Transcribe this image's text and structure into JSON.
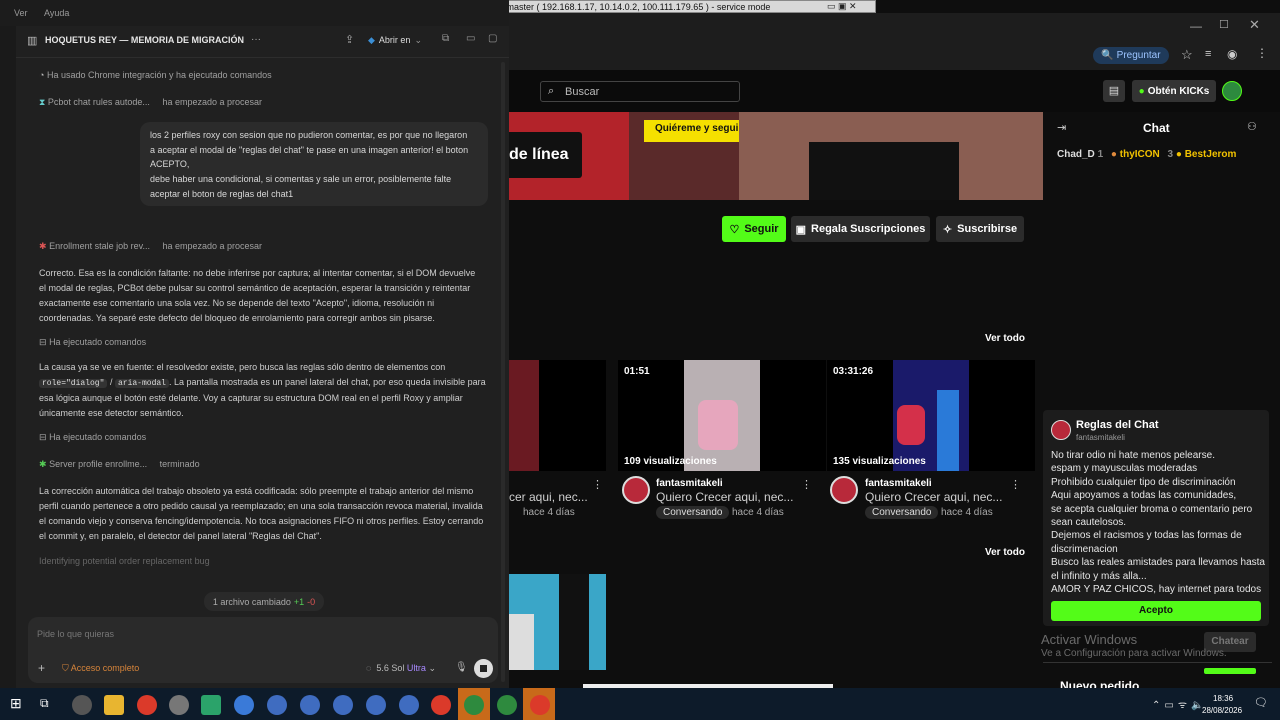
{
  "remote_title": "pcmaster ( 192.168.1.17, 10.14.0.2, 100.111.179.65 ) - service mode",
  "left_panel": {
    "menu": [
      "Ver",
      "Ayuda"
    ],
    "title": "HOQUETUS REY — MEMORIA DE MIGRACIÓN",
    "open_in_label": "Abrir en",
    "status1": "Ha usado Chrome integración y ha ejecutado comandos",
    "task1_name": "Pcbot chat rules autode...",
    "task1_state": "ha empezado a procesar",
    "bubble_lines": [
      "los 2 perfiles roxy con sesion que no pudieron comentar, es por que no llegaron",
      "a aceptar el modal de \"reglas del chat\" te pase en una imagen anterior! el boton",
      "ACEPTO,",
      "debe haber una condicional, si comentas y sale un error, posiblemente falte",
      "aceptar el boton de reglas del chat1"
    ],
    "task2_name": "Enrollment stale job rev...",
    "task2_state": "ha empezado a procesar",
    "para1": [
      "Correcto. Esa es la condición faltante: no debe inferirse por captura; al intentar comentar, si el DOM devuelve",
      "el modal de reglas, PCBot debe pulsar su control semántico de aceptación, esperar la transición y reintentar",
      "exactamente ese comentario una sola vez. No se depende del texto \"Acepto\", idioma, resolución ni",
      "coordenadas. Ya separé este defecto del bloqueo de enrolamiento para corregir ambos sin pisarse."
    ],
    "exec1": "Ha ejecutado comandos",
    "para2_line1": "La causa ya se ve en fuente: el resolvedor existe, pero busca las reglas sólo dentro de elementos con",
    "para2_code1": "role=\"dialog\"",
    "para2_sep": "/",
    "para2_code2": "aria-modal",
    "para2_line2_rest": ". La pantalla mostrada es un panel lateral del chat, por eso queda invisible para",
    "para2_line3": "esa lógica aunque el botón esté delante. Voy a capturar su estructura DOM real en el perfil Roxy y ampliar",
    "para2_line4": "únicamente ese detector semántico.",
    "exec2": "Ha ejecutado comandos",
    "task3_name": "Server profile enrollme...",
    "task3_state": "terminado",
    "para3": [
      "La corrección automática del trabajo obsoleto ya está codificada: sólo preempte el trabajo anterior del mismo",
      "perfil cuando pertenece a otro pedido causal ya reemplazado; en una sola transacción revoca material, invalida",
      "el comando viejo y conserva fencing/idempotencia. No toca asignaciones FIFO ni otros perfiles. Estoy cerrando",
      "el commit y, en paralelo, el detector del panel lateral \"Reglas del Chat\"."
    ],
    "thinking": "Identifying potential order replacement bug",
    "files_changed": "1 archivo cambiado",
    "files_plus": "+1",
    "files_minus": "-0",
    "input_placeholder": "Pide lo que quieras",
    "access_label": "Acceso completo",
    "model_label": "5.6 Sol",
    "model_tier": "Ultra"
  },
  "stream": {
    "search_placeholder": "Buscar",
    "get_kicks": "Obtén KICKs",
    "offline_text": "de línea",
    "banner_text": "Quiéreme y seguir",
    "follow_label": "Seguir",
    "gift_label": "Regala Suscripciones",
    "subscribe_label": "Suscribirse",
    "see_all_1": "Ver todo",
    "see_all_2": "Ver todo",
    "videos": [
      {
        "duration": "",
        "views": "",
        "channel": "",
        "title": "cer aqui, nec...",
        "tag": "",
        "ago": "hace 4 días"
      },
      {
        "duration": "01:51",
        "views": "109 visualizaciones",
        "channel": "fantasmitakeli",
        "title": "Quiero Crecer aqui, nec...",
        "tag": "Conversando",
        "ago": "hace 4 días"
      },
      {
        "duration": "03:31:26",
        "views": "135 visualizaciones",
        "channel": "fantasmitakeli",
        "title": "Quiero Crecer aqui, nec...",
        "tag": "Conversando",
        "ago": "hace 4 días"
      }
    ]
  },
  "chat": {
    "title": "Chat",
    "users": [
      {
        "name": "Chad_D",
        "count": "1"
      },
      {
        "name": "thyICON",
        "count": "3"
      },
      {
        "name": "BestJerom",
        "count": "1"
      }
    ],
    "rules_title": "Reglas del Chat",
    "rules_channel": "fantasmitakeli",
    "rules_lines": [
      "No tirar odio ni hate menos pelearse.",
      "espam y mayusculas moderadas",
      "Prohibido cualquier tipo de discriminación",
      "Aqui apoyamos a todas las comunidades,",
      "se acepta cualquier broma o comentario pero",
      "sean cautelosos.",
      "Dejemos el racismos y todas las formas de",
      "discrimenacion",
      "Busco las reales amistades para llevamos hasta",
      "el infinito y más alla...",
      "AMOR Y PAZ CHICOS, hay internet para todos"
    ],
    "accept_label": "Acepto",
    "chat_button": "Chatear",
    "watermark_1": "Activar Windows",
    "watermark_2": "Ve a Configuración para activar Windows.",
    "new_stream": "Nuevo pedido"
  },
  "taskbar": {
    "time": "18:36",
    "date": "28/08/2026"
  },
  "colors": {
    "kick_green": "#53fc18",
    "left_bg": "#202020",
    "stream_bg": "#0e0e0e"
  }
}
